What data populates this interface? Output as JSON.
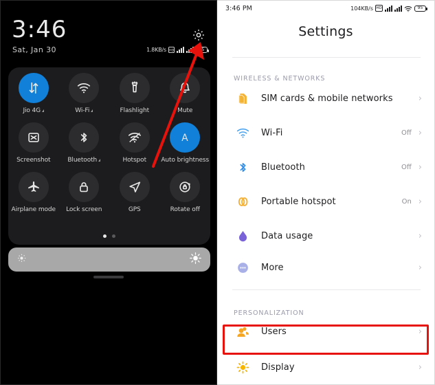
{
  "left_panel": {
    "name": "quick-settings-shade",
    "clock": "3:46",
    "date": "Sat, Jan 30",
    "status_bar": {
      "network_speed": "1.8KB/s",
      "battery_percent": "95",
      "icons": [
        "hd-icon",
        "signal-bars-icon",
        "signal-bars-icon",
        "battery-icon"
      ]
    },
    "gear_icon": "gear-icon",
    "tiles": [
      {
        "label": "Jio 4G",
        "icon": "mobile-data-icon",
        "active": true,
        "caret": true
      },
      {
        "label": "Wi-Fi",
        "icon": "wifi-icon",
        "active": false,
        "caret": true
      },
      {
        "label": "Flashlight",
        "icon": "flashlight-icon",
        "active": false,
        "caret": false
      },
      {
        "label": "Mute",
        "icon": "bell-icon",
        "active": false,
        "caret": false
      },
      {
        "label": "Screenshot",
        "icon": "screenshot-icon",
        "active": false,
        "caret": false
      },
      {
        "label": "Bluetooth",
        "icon": "bluetooth-icon",
        "active": false,
        "caret": true
      },
      {
        "label": "Hotspot",
        "icon": "hotspot-icon",
        "active": false,
        "caret": false
      },
      {
        "label": "Auto brightness",
        "icon": "auto-brightness-icon",
        "active": true,
        "caret": false
      },
      {
        "label": "Airplane mode",
        "icon": "airplane-icon",
        "active": false,
        "caret": false
      },
      {
        "label": "Lock screen",
        "icon": "lock-icon",
        "active": false,
        "caret": false
      },
      {
        "label": "GPS",
        "icon": "location-arrow-icon",
        "active": false,
        "caret": false
      },
      {
        "label": "Rotate off",
        "icon": "rotate-lock-icon",
        "active": false,
        "caret": false
      }
    ],
    "page_dots": {
      "count": 2,
      "active_index": 0
    },
    "brightness_slider": {
      "low_icon": "brightness-low-icon",
      "high_icon": "brightness-high-icon",
      "track_color": "#a8a8a8"
    },
    "annotation": {
      "type": "arrow",
      "color": "#e8120c",
      "points_to": "gear-icon"
    }
  },
  "right_panel": {
    "name": "settings-screen",
    "status_bar": {
      "time": "3:46 PM",
      "network_speed": "104KB/s",
      "battery_percent": "95",
      "icons": [
        "hd-icon",
        "signal-bars-icon",
        "signal-bars-icon",
        "wifi-icon",
        "battery-icon"
      ]
    },
    "title": "Settings",
    "sections": [
      {
        "header": "WIRELESS & NETWORKS",
        "rows": [
          {
            "label": "SIM cards & mobile networks",
            "value": "",
            "icon": "sim-card-icon",
            "icon_color": "#f5b335"
          },
          {
            "label": "Wi-Fi",
            "value": "Off",
            "icon": "wifi-icon",
            "icon_color": "#4aa3ef"
          },
          {
            "label": "Bluetooth",
            "value": "Off",
            "icon": "bluetooth-icon",
            "icon_color": "#2a8ef0"
          },
          {
            "label": "Portable hotspot",
            "value": "On",
            "icon": "hotspot-rings-icon",
            "icon_color": "#f3b13a"
          },
          {
            "label": "Data usage",
            "value": "",
            "icon": "data-usage-drop-icon",
            "icon_color": "#7a63d8"
          },
          {
            "label": "More",
            "value": "",
            "icon": "more-dots-icon",
            "icon_color": "#a9b0e8"
          }
        ]
      },
      {
        "header": "PERSONALIZATION",
        "rows": [
          {
            "label": "Users",
            "value": "",
            "icon": "users-icon",
            "icon_color": "#f5a623",
            "highlighted": true
          },
          {
            "label": "Display",
            "value": "",
            "icon": "display-sun-icon",
            "icon_color": "#f7b500"
          }
        ]
      }
    ],
    "chevron": "›",
    "highlight_color": "#e8120c"
  }
}
